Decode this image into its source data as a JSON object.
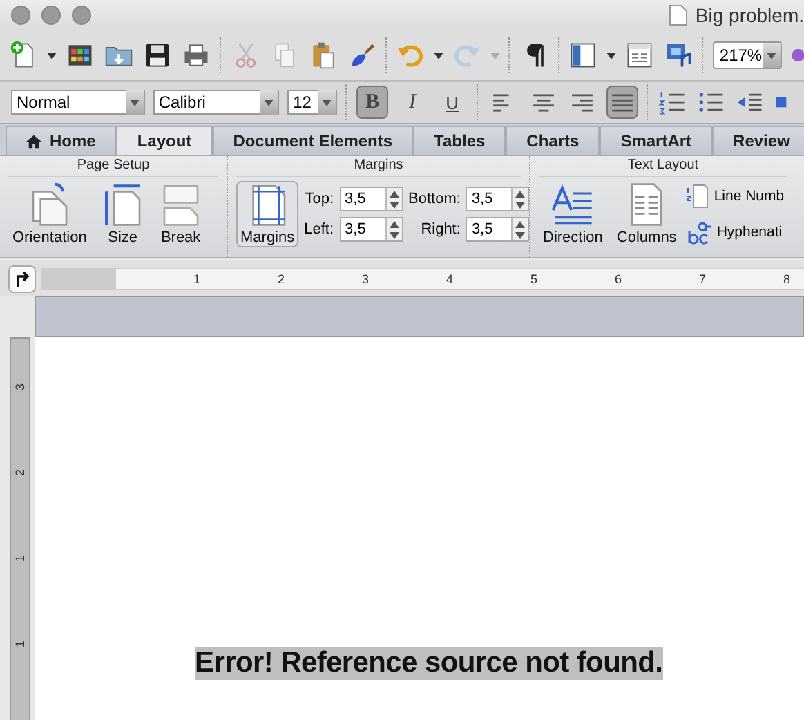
{
  "window": {
    "title": "Big problem."
  },
  "toolbar": {
    "zoom": "217%"
  },
  "format_bar": {
    "style": "Normal",
    "font": "Calibri",
    "size": "12",
    "buttons": [
      {
        "kind": "bold",
        "label": "B",
        "selected": true
      },
      {
        "kind": "italic",
        "label": "I",
        "selected": false
      },
      {
        "kind": "underline",
        "label": "U",
        "selected": false
      }
    ],
    "alignments": [
      {
        "kind": "left",
        "selected": false
      },
      {
        "kind": "center",
        "selected": false
      },
      {
        "kind": "right",
        "selected": false
      },
      {
        "kind": "justify",
        "selected": true
      }
    ]
  },
  "tabs": [
    {
      "label": "Home",
      "kind": "home",
      "selected": false
    },
    {
      "label": "Layout",
      "kind": "plain",
      "selected": true
    },
    {
      "label": "Document Elements",
      "kind": "plain",
      "selected": false
    },
    {
      "label": "Tables",
      "kind": "plain",
      "selected": false
    },
    {
      "label": "Charts",
      "kind": "plain",
      "selected": false
    },
    {
      "label": "SmartArt",
      "kind": "plain",
      "selected": false
    },
    {
      "label": "Review",
      "kind": "plain",
      "selected": false
    }
  ],
  "ribbon": {
    "page_setup": {
      "title": "Page Setup",
      "buttons": [
        "Orientation",
        "Size",
        "Break"
      ]
    },
    "margins": {
      "title": "Margins",
      "button": "Margins",
      "fields": [
        {
          "label": "Top:",
          "value": "3,5"
        },
        {
          "label": "Bottom:",
          "value": "3,5"
        },
        {
          "label": "Left:",
          "value": "3,5"
        },
        {
          "label": "Right:",
          "value": "3,5"
        }
      ]
    },
    "text_layout": {
      "title": "Text Layout",
      "buttons": [
        "Direction",
        "Columns"
      ],
      "items": [
        "Line Numb",
        "Hyphenati"
      ]
    }
  },
  "ruler": {
    "numbers": [
      "1",
      "2",
      "3",
      "4",
      "5",
      "6",
      "7",
      "8"
    ],
    "vertical_numbers": [
      "3",
      "2",
      "1",
      "1"
    ]
  },
  "document": {
    "text": "Error! Reference source not found."
  }
}
